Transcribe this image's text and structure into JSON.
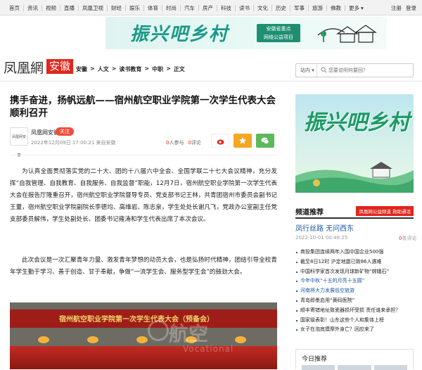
{
  "topnav": {
    "items": [
      "首页",
      "资讯",
      "视频",
      "直播",
      "凤凰卫视",
      "财经",
      "娱乐",
      "体育",
      "时尚",
      "汽车",
      "房产",
      "科技",
      "读书",
      "文化",
      "历史",
      "军事",
      "旅游",
      "佛教"
    ],
    "more": "更多",
    "register": "注册",
    "login": "登录"
  },
  "banner": {
    "title": "振兴吧乡村",
    "badge_line1": "安徽省重点",
    "badge_line2": "网络公益项目",
    "colors": {
      "main": "#1a9a86",
      "badge": "#1f8f72"
    }
  },
  "header": {
    "logo": "凤凰網",
    "region": "安徽",
    "breadcrumb": [
      "安徽",
      ">",
      "人文",
      ">",
      "读书教育",
      ">",
      "中职",
      ">",
      "正文"
    ],
    "search_scope": "站内",
    "search_placeholder": "您要说明何要回？"
  },
  "article": {
    "title": "携手奋进，扬帆远航——宿州航空职业学院第一次学生代表大会顺利召开",
    "source_icon_label": "凤凰网安徽",
    "source": "凤凰网安徽",
    "follow": "关注",
    "date": "2022年12月09日 17:00:21 来自安徽",
    "participants_num": "0",
    "participants_label": "人参与",
    "comments_num": "0",
    "comments_label": "评论",
    "paragraphs": [
      "为认真全面贯彻落实党的二十大、团的十八届六中全会、全国学联二十七大会议精神，充分发挥“自我管理、自我教育、自我服务、自我监督”职能，12月7日，宿州航空职业学院第一次学生代表大会在报告厅隆重召开，宿州航空职业学院督导专员、党支部书记王林，共青团宿州市委员会副书记王董，宿州航空职业学院副院长李德均、高维岩、陈志泉，学生处处长谢凡飞，党政办公室副主任党支部委员解伟，学生处副处长、团委书记雍涛和学生代表出席了本次会议。",
      "此次会议是一次汇聚青年力量、激发青年梦想的动员大会，也是弘扬时代精神，团结引导全校青年学生勤于学习、善于创造、甘于奉献，争做“一流学生会、服务型学生会”的鼓劲大会。"
    ],
    "photo_banner": "宿州航空职业学院第一次学生代表大会（预备会）",
    "watermark": "航空",
    "watermark_en": "Vocational"
  },
  "sidebar": {
    "ad_title": "振兴吧乡村",
    "rec_title": "频道推荐",
    "rec_badge": "凤凰网公益频道 救助通话",
    "featured_title": "凤行丝路 无问西东",
    "featured_date": "2022-10-01 00:48:25",
    "featured_comments_num": "0",
    "featured_comments_label": "条评论",
    "list": [
      "商投集团连续两年入围中国企业500强",
      "截至8日12时 沪定地震已致86人遇难",
      "中国科学家首次发现月球新矿物“嫦娥石”",
      "今年中秋“十五的月亮十五圆”",
      "河南将大力发展低空旅游",
      "青岛即墨启用“黄码医院”",
      "顺丰寄错地址致瓷器损坏受损 责任谁来承担？",
      "国家级表彰！山东这些个人和集体上榜",
      "女子在泡底摸摩外身亡？回应来了"
    ],
    "today_title": "今日推荐",
    "accent": "#e2261c",
    "link_color": "#1b57a3"
  }
}
